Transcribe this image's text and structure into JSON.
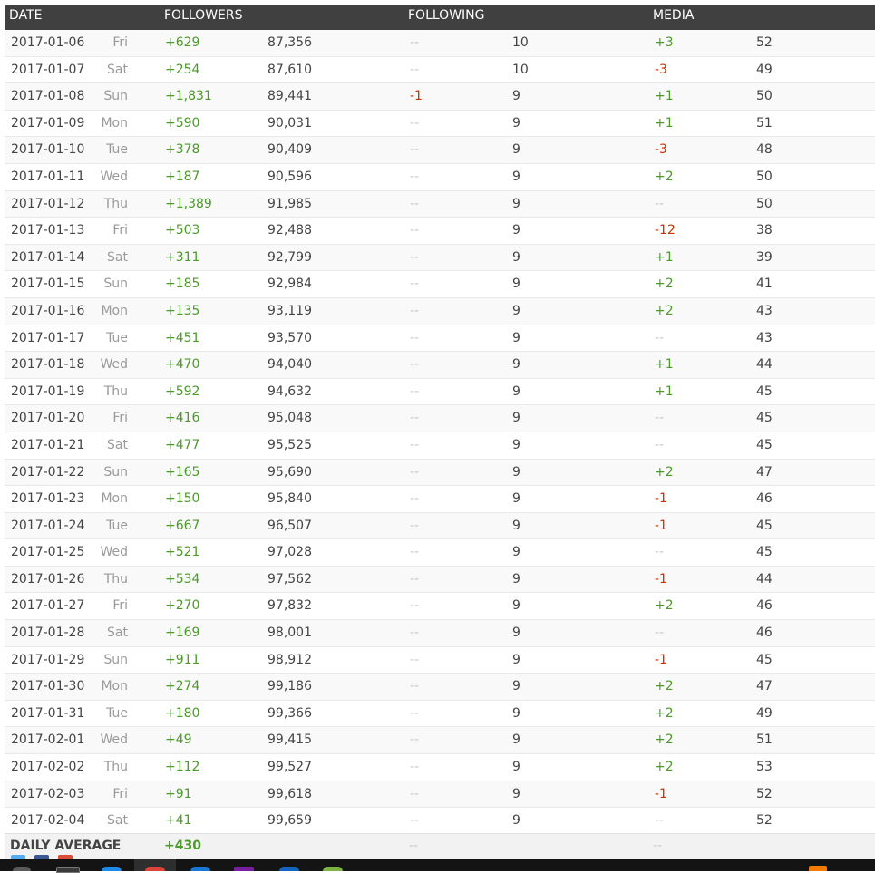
{
  "header": {
    "date": "DATE",
    "followers": "FOLLOWERS",
    "following": "FOLLOWING",
    "media": "MEDIA"
  },
  "rows": [
    {
      "date": "2017-01-06",
      "day": "Fri",
      "followers_change": "+629",
      "followers": "87,356",
      "following_change": "--",
      "following": "10",
      "media_change": "+3",
      "media": "52"
    },
    {
      "date": "2017-01-07",
      "day": "Sat",
      "followers_change": "+254",
      "followers": "87,610",
      "following_change": "--",
      "following": "10",
      "media_change": "-3",
      "media": "49"
    },
    {
      "date": "2017-01-08",
      "day": "Sun",
      "followers_change": "+1,831",
      "followers": "89,441",
      "following_change": "-1",
      "following": "9",
      "media_change": "+1",
      "media": "50"
    },
    {
      "date": "2017-01-09",
      "day": "Mon",
      "followers_change": "+590",
      "followers": "90,031",
      "following_change": "--",
      "following": "9",
      "media_change": "+1",
      "media": "51"
    },
    {
      "date": "2017-01-10",
      "day": "Tue",
      "followers_change": "+378",
      "followers": "90,409",
      "following_change": "--",
      "following": "9",
      "media_change": "-3",
      "media": "48"
    },
    {
      "date": "2017-01-11",
      "day": "Wed",
      "followers_change": "+187",
      "followers": "90,596",
      "following_change": "--",
      "following": "9",
      "media_change": "+2",
      "media": "50"
    },
    {
      "date": "2017-01-12",
      "day": "Thu",
      "followers_change": "+1,389",
      "followers": "91,985",
      "following_change": "--",
      "following": "9",
      "media_change": "--",
      "media": "50"
    },
    {
      "date": "2017-01-13",
      "day": "Fri",
      "followers_change": "+503",
      "followers": "92,488",
      "following_change": "--",
      "following": "9",
      "media_change": "-12",
      "media": "38"
    },
    {
      "date": "2017-01-14",
      "day": "Sat",
      "followers_change": "+311",
      "followers": "92,799",
      "following_change": "--",
      "following": "9",
      "media_change": "+1",
      "media": "39"
    },
    {
      "date": "2017-01-15",
      "day": "Sun",
      "followers_change": "+185",
      "followers": "92,984",
      "following_change": "--",
      "following": "9",
      "media_change": "+2",
      "media": "41"
    },
    {
      "date": "2017-01-16",
      "day": "Mon",
      "followers_change": "+135",
      "followers": "93,119",
      "following_change": "--",
      "following": "9",
      "media_change": "+2",
      "media": "43"
    },
    {
      "date": "2017-01-17",
      "day": "Tue",
      "followers_change": "+451",
      "followers": "93,570",
      "following_change": "--",
      "following": "9",
      "media_change": "--",
      "media": "43"
    },
    {
      "date": "2017-01-18",
      "day": "Wed",
      "followers_change": "+470",
      "followers": "94,040",
      "following_change": "--",
      "following": "9",
      "media_change": "+1",
      "media": "44"
    },
    {
      "date": "2017-01-19",
      "day": "Thu",
      "followers_change": "+592",
      "followers": "94,632",
      "following_change": "--",
      "following": "9",
      "media_change": "+1",
      "media": "45"
    },
    {
      "date": "2017-01-20",
      "day": "Fri",
      "followers_change": "+416",
      "followers": "95,048",
      "following_change": "--",
      "following": "9",
      "media_change": "--",
      "media": "45"
    },
    {
      "date": "2017-01-21",
      "day": "Sat",
      "followers_change": "+477",
      "followers": "95,525",
      "following_change": "--",
      "following": "9",
      "media_change": "--",
      "media": "45"
    },
    {
      "date": "2017-01-22",
      "day": "Sun",
      "followers_change": "+165",
      "followers": "95,690",
      "following_change": "--",
      "following": "9",
      "media_change": "+2",
      "media": "47"
    },
    {
      "date": "2017-01-23",
      "day": "Mon",
      "followers_change": "+150",
      "followers": "95,840",
      "following_change": "--",
      "following": "9",
      "media_change": "-1",
      "media": "46"
    },
    {
      "date": "2017-01-24",
      "day": "Tue",
      "followers_change": "+667",
      "followers": "96,507",
      "following_change": "--",
      "following": "9",
      "media_change": "-1",
      "media": "45"
    },
    {
      "date": "2017-01-25",
      "day": "Wed",
      "followers_change": "+521",
      "followers": "97,028",
      "following_change": "--",
      "following": "9",
      "media_change": "--",
      "media": "45"
    },
    {
      "date": "2017-01-26",
      "day": "Thu",
      "followers_change": "+534",
      "followers": "97,562",
      "following_change": "--",
      "following": "9",
      "media_change": "-1",
      "media": "44"
    },
    {
      "date": "2017-01-27",
      "day": "Fri",
      "followers_change": "+270",
      "followers": "97,832",
      "following_change": "--",
      "following": "9",
      "media_change": "+2",
      "media": "46"
    },
    {
      "date": "2017-01-28",
      "day": "Sat",
      "followers_change": "+169",
      "followers": "98,001",
      "following_change": "--",
      "following": "9",
      "media_change": "--",
      "media": "46"
    },
    {
      "date": "2017-01-29",
      "day": "Sun",
      "followers_change": "+911",
      "followers": "98,912",
      "following_change": "--",
      "following": "9",
      "media_change": "-1",
      "media": "45"
    },
    {
      "date": "2017-01-30",
      "day": "Mon",
      "followers_change": "+274",
      "followers": "99,186",
      "following_change": "--",
      "following": "9",
      "media_change": "+2",
      "media": "47"
    },
    {
      "date": "2017-01-31",
      "day": "Tue",
      "followers_change": "+180",
      "followers": "99,366",
      "following_change": "--",
      "following": "9",
      "media_change": "+2",
      "media": "49"
    },
    {
      "date": "2017-02-01",
      "day": "Wed",
      "followers_change": "+49",
      "followers": "99,415",
      "following_change": "--",
      "following": "9",
      "media_change": "+2",
      "media": "51"
    },
    {
      "date": "2017-02-02",
      "day": "Thu",
      "followers_change": "+112",
      "followers": "99,527",
      "following_change": "--",
      "following": "9",
      "media_change": "+2",
      "media": "53"
    },
    {
      "date": "2017-02-03",
      "day": "Fri",
      "followers_change": "+91",
      "followers": "99,618",
      "following_change": "--",
      "following": "9",
      "media_change": "-1",
      "media": "52"
    },
    {
      "date": "2017-02-04",
      "day": "Sat",
      "followers_change": "+41",
      "followers": "99,659",
      "following_change": "--",
      "following": "9",
      "media_change": "--",
      "media": "52"
    }
  ],
  "footer": {
    "label": "DAILY AVERAGE",
    "followers_avg": "+430",
    "following_avg": "--",
    "media_avg": "--"
  },
  "colors": {
    "positive": "#4c9a2a",
    "negative": "#cc3300",
    "neutral": "#c8c8c8",
    "header_bg": "#404040"
  },
  "share_icons": [
    "twitter-icon",
    "facebook-icon",
    "google-plus-icon"
  ],
  "taskbar_icons": [
    "start-icon",
    "file-explorer-icon",
    "edge-icon",
    "chrome-icon",
    "ie-icon",
    "onenote-icon",
    "app-icon",
    "app-icon",
    "tray-icon"
  ]
}
